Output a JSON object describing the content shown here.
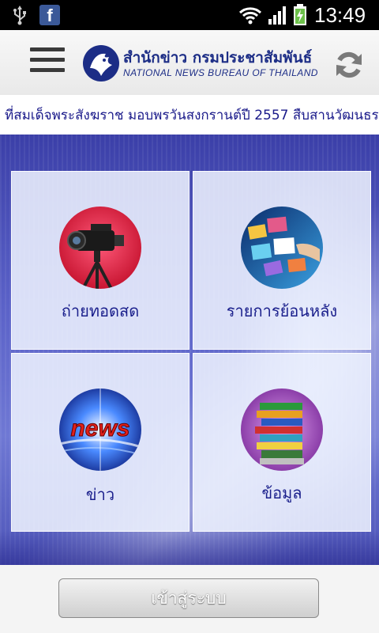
{
  "status_bar": {
    "time": "13:49",
    "icons": [
      "usb-icon",
      "facebook-icon",
      "wifi-icon",
      "signal-icon",
      "battery-charging-icon"
    ],
    "facebook_letter": "f"
  },
  "header": {
    "logo_title_th": "สำนักข่าว กรมประชาสัมพันธ์",
    "logo_title_en": "NATIONAL NEWS BUREAU OF THAILAND",
    "menu_icon": "hamburger-menu-icon",
    "refresh_icon": "refresh-icon"
  },
  "ticker": {
    "text": "ที่สมเด็จพระสังฆราช มอบพรวันสงกรานต์ปี 2557 สืบสานวัฒนธรรม"
  },
  "tiles": [
    {
      "label": "ถ่ายทอดสด",
      "icon": "video-camera-icon"
    },
    {
      "label": "รายการย้อนหลัง",
      "icon": "media-screens-icon"
    },
    {
      "label": "ข่าว",
      "icon": "news-icon",
      "image_text": "news"
    },
    {
      "label": "ข้อมูล",
      "icon": "books-icon"
    }
  ],
  "login_button": {
    "label": "เข้าสู่ระบบ"
  },
  "colors": {
    "brand_blue": "#1c2d86",
    "background_blue": "#5b62c8",
    "status_bar": "#000000"
  }
}
